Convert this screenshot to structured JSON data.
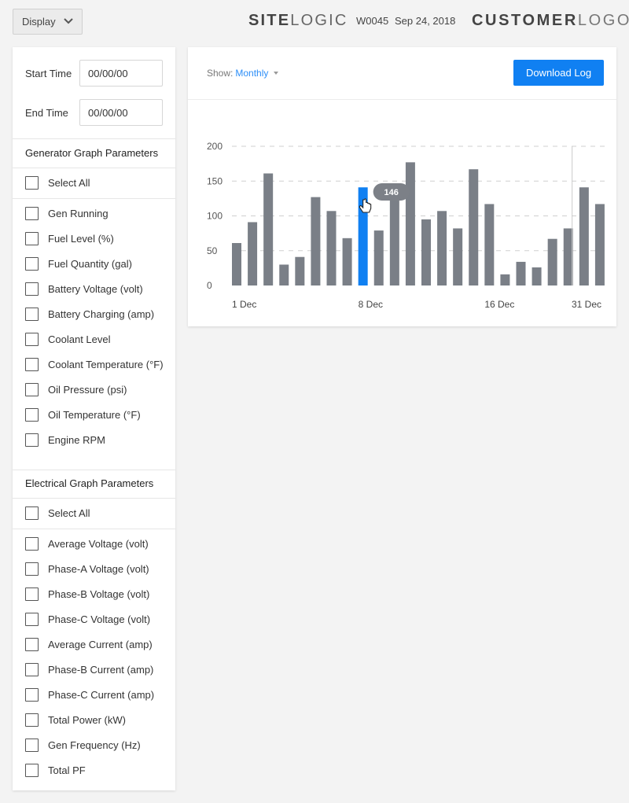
{
  "topbar": {
    "display_label": "Display",
    "brand_bold": "SITE",
    "brand_light": "LOGIC",
    "site_id": "W0045",
    "date": "Sep 24, 2018",
    "customer_bold": "CUSTOMER",
    "customer_light": "LOGO"
  },
  "filters": {
    "start_label": "Start Time",
    "start_value": "00/00/00",
    "end_label": "End Time",
    "end_value": "00/00/00"
  },
  "generator": {
    "title": "Generator Graph Parameters",
    "select_all": "Select All",
    "items": [
      "Gen Running",
      "Fuel Level (%)",
      "Fuel Quantity (gal)",
      "Battery Voltage (volt)",
      "Battery Charging (amp)",
      "Coolant Level",
      "Coolant Temperature (°F)",
      "Oil Pressure (psi)",
      "Oil Temperature (°F)",
      "Engine RPM"
    ]
  },
  "electrical": {
    "title": "Electrical Graph Parameters",
    "select_all": "Select All",
    "items": [
      "Average Voltage (volt)",
      "Phase-A Voltage (volt)",
      "Phase-B Voltage (volt)",
      "Phase-C Voltage (volt)",
      "Average Current (amp)",
      "Phase-B Current (amp)",
      "Phase-C Current (amp)",
      "Total Power (kW)",
      "Gen Frequency (Hz)",
      "Total PF"
    ]
  },
  "panel": {
    "show_label": "Show:",
    "show_value": "Monthly",
    "download_label": "Download Log"
  },
  "colors": {
    "bar": "#7a7f87",
    "bar_active": "#1080f2",
    "accent": "#2c8ef8"
  },
  "chart_data": {
    "type": "bar",
    "values": [
      61,
      91,
      161,
      30,
      41,
      127,
      107,
      68,
      141,
      79,
      137,
      177,
      95,
      107,
      82,
      167,
      117,
      16,
      34,
      26,
      67,
      82,
      141,
      117
    ],
    "x_tick_labels": [
      "1 Dec",
      "8 Dec",
      "16 Dec",
      "31 Dec"
    ],
    "y_ticks": [
      0,
      50,
      100,
      150,
      200
    ],
    "ylim": [
      0,
      200
    ],
    "grid": true,
    "highlighted_index": 8,
    "tooltip_value": "146"
  }
}
